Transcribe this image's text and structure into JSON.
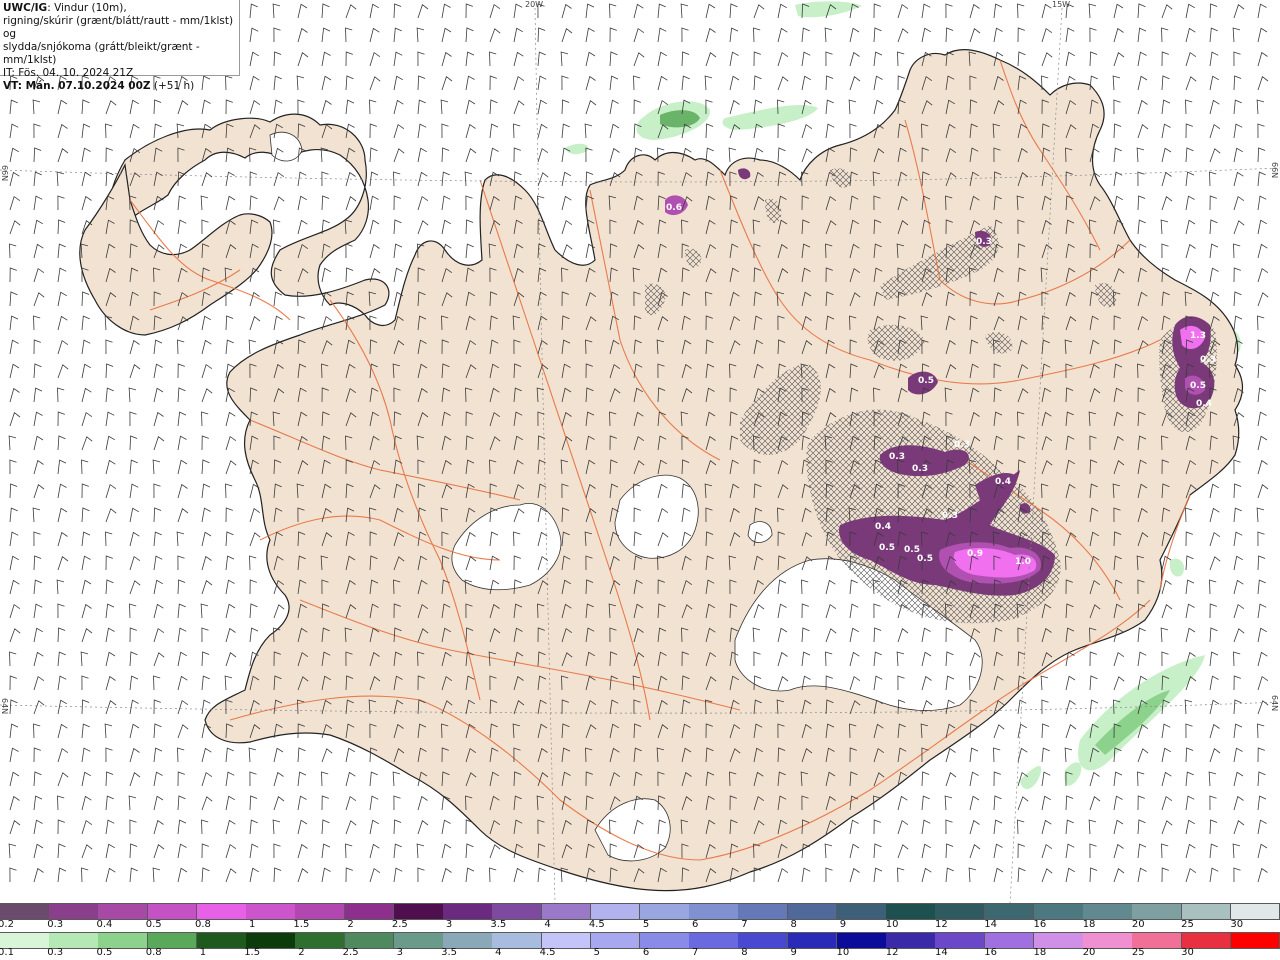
{
  "info": {
    "model": "UWC/IG",
    "line1_rest": ": Vindur (10m),",
    "line2": "rigning/skúrir (grænt/blátt/rautt - mm/1klst) og",
    "line3": "slydda/snjókoma (grátt/bleikt/grænt - mm/1klst)",
    "it": "IT: Fös. 04. 10. 2024 21Z",
    "vt_bold": "VT: Mán. 07.10.2024 00Z",
    "vt_rest": " (+51 h)"
  },
  "grid_labels": {
    "lon_20w": "20W",
    "lon_15w": "15W",
    "lat_66n_left": "66N",
    "lat_66n_right": "66N",
    "lat_64n_left": "64N",
    "lat_64n_right": "64N"
  },
  "snow_labels": [
    "0.6",
    "0.3",
    "0.5",
    "0.3",
    "0.3",
    "0.3",
    "0.4",
    "0.3",
    "0.4",
    "0.5",
    "0.5",
    "0.5",
    "0.9",
    "1.0",
    "1.3",
    "0.3",
    "0.5",
    "0.4"
  ],
  "legend_sleet": {
    "labels": [
      "0.2",
      "0.3",
      "0.4",
      "0.5",
      "0.8",
      "1",
      "1.5",
      "2",
      "2.5",
      "3",
      "3.5",
      "4",
      "4.5",
      "5",
      "6",
      "7",
      "8",
      "9",
      "10",
      "12",
      "14",
      "16",
      "18",
      "20",
      "25",
      "30"
    ],
    "colors": [
      "#6b4a6b",
      "#8a3f8a",
      "#a64aa6",
      "#c452c4",
      "#e85fe8",
      "#cc55cc",
      "#b247b2",
      "#8e2f8e",
      "#4f0f4f",
      "#6a2a80",
      "#7d4aa0",
      "#9a7ac8",
      "#b2b2ee",
      "#9aa6e0",
      "#8090d0",
      "#6578b8",
      "#4f6a9a",
      "#3d6078",
      "#1e5050",
      "#2f5a60",
      "#3e6870",
      "#4d7880",
      "#628890",
      "#7ea0a0",
      "#a8c0c0",
      "#e0e8e8"
    ]
  },
  "legend_rain": {
    "labels": [
      "0.1",
      "0.3",
      "0.5",
      "0.8",
      "1",
      "1.5",
      "2",
      "2.5",
      "3",
      "3.5",
      "4",
      "4.5",
      "5",
      "6",
      "7",
      "8",
      "9",
      "10",
      "12",
      "14",
      "16",
      "18",
      "20",
      "25",
      "30"
    ],
    "colors": [
      "#d8f5d8",
      "#b4e8b4",
      "#8cd28c",
      "#5aa85a",
      "#1e5a1e",
      "#0c3c0c",
      "#2e6e2e",
      "#4e8a5e",
      "#6a9a8a",
      "#8aa8b8",
      "#a8bce0",
      "#c4c4f8",
      "#a8a8f0",
      "#8a8ae8",
      "#6a6ae0",
      "#4848d0",
      "#2a2ab8",
      "#0c0c9a",
      "#3a2aa8",
      "#6a48c8",
      "#a070e0",
      "#d090e8",
      "#f090d0",
      "#f07098",
      "#e83040",
      "#ff0000"
    ]
  },
  "colors": {
    "land": "#f2e2d2",
    "glacier": "#ffffff",
    "roads": "#e8703c",
    "coast": "#222222",
    "barbs": "#3a3a3a",
    "snow_dark": "#7a3a7a",
    "snow_mid": "#b050b0",
    "snow_bright": "#f070f0",
    "rain_light": "#c8f0c8",
    "rain_mid": "#6ab46a"
  }
}
